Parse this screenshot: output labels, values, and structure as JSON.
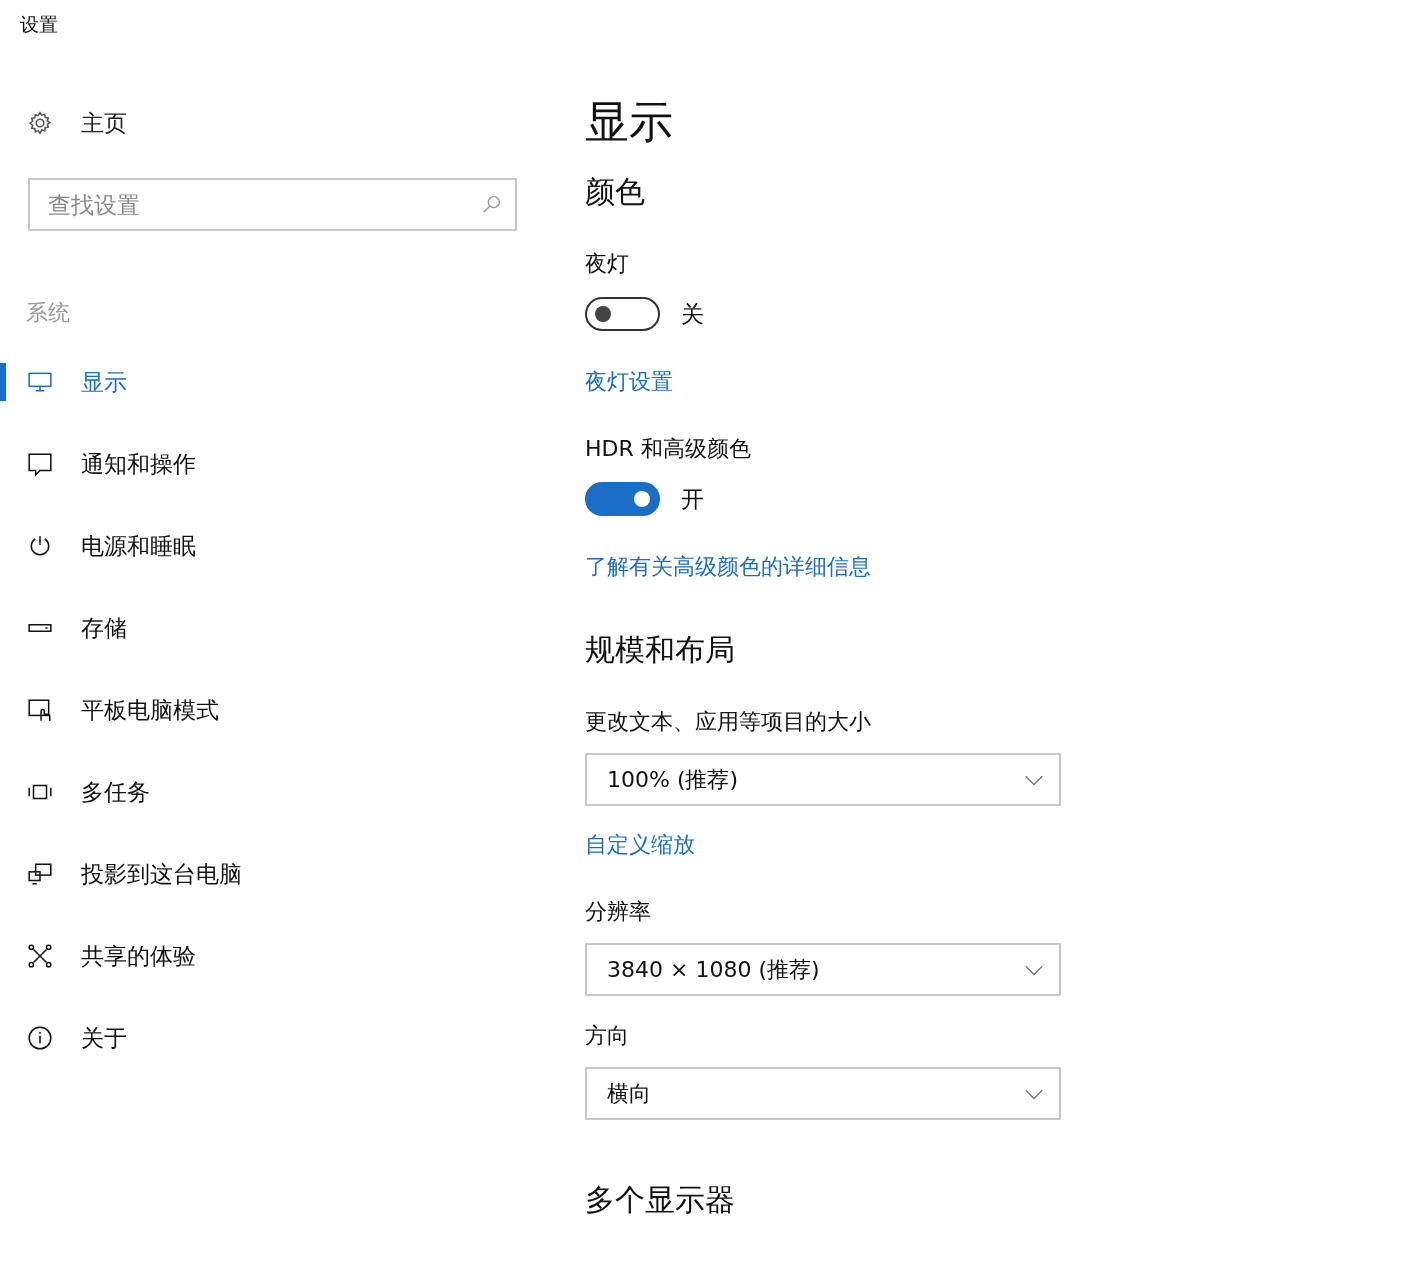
{
  "window": {
    "title": "设置"
  },
  "sidebar": {
    "home": {
      "label": "主页"
    },
    "search": {
      "placeholder": "查找设置"
    },
    "section": "系统",
    "items": [
      {
        "label": "显示",
        "selected": true
      },
      {
        "label": "通知和操作",
        "selected": false
      },
      {
        "label": "电源和睡眠",
        "selected": false
      },
      {
        "label": "存储",
        "selected": false
      },
      {
        "label": "平板电脑模式",
        "selected": false
      },
      {
        "label": "多任务",
        "selected": false
      },
      {
        "label": "投影到这台电脑",
        "selected": false
      },
      {
        "label": "共享的体验",
        "selected": false
      },
      {
        "label": "关于",
        "selected": false
      }
    ]
  },
  "main": {
    "title": "显示",
    "blocks": [
      {
        "kind": "heading",
        "text": "颜色"
      },
      {
        "kind": "label",
        "text": "夜灯"
      },
      {
        "kind": "toggle",
        "on": false,
        "state_text": "关"
      },
      {
        "kind": "link",
        "text": "夜灯设置"
      },
      {
        "kind": "label",
        "text": "HDR 和高级颜色"
      },
      {
        "kind": "toggle",
        "on": true,
        "state_text": "开"
      },
      {
        "kind": "link",
        "text": "了解有关高级颜色的详细信息"
      },
      {
        "kind": "heading",
        "text": "规模和布局"
      },
      {
        "kind": "label",
        "text": "更改文本、应用等项目的大小"
      },
      {
        "kind": "dropdown",
        "value": "100% (推荐)"
      },
      {
        "kind": "link",
        "text": "自定义缩放"
      },
      {
        "kind": "label",
        "text": "分辨率"
      },
      {
        "kind": "dropdown",
        "value": "3840 × 1080 (推荐)"
      },
      {
        "kind": "label",
        "text": "方向"
      },
      {
        "kind": "dropdown",
        "value": "横向"
      },
      {
        "kind": "heading",
        "text": "多个显示器"
      }
    ]
  }
}
